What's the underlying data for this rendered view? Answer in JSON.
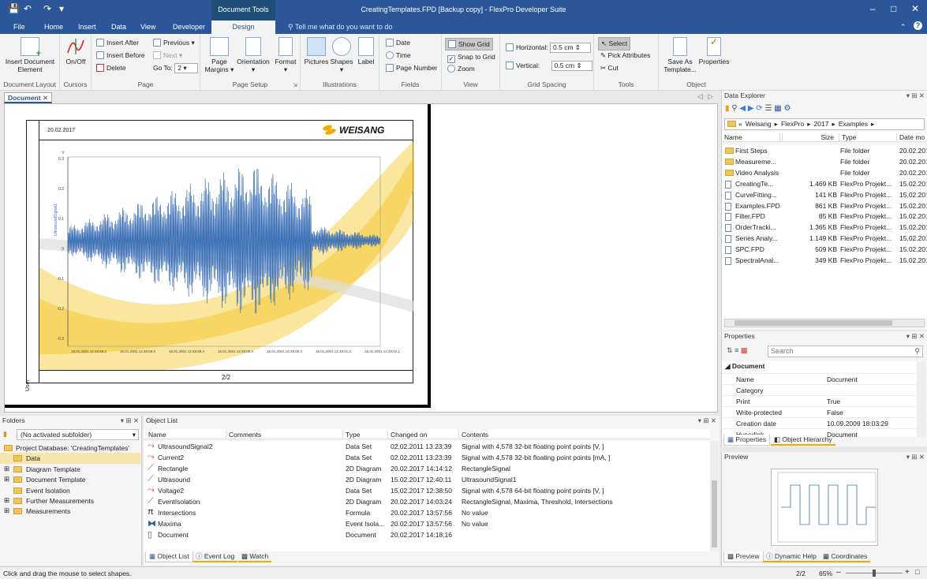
{
  "window": {
    "title": "CreatingTemplates.FPD [Backup copy] - FlexPro Developer Suite",
    "context_tab": "Document Tools"
  },
  "menu": [
    "File",
    "Home",
    "Insert",
    "Data",
    "View",
    "Developer"
  ],
  "active_tab": "Design",
  "tell_me": "Tell me what do you want to do",
  "ribbon": {
    "document_layout": {
      "label": "Document Layout",
      "insert": "Insert Document Element"
    },
    "cursors": {
      "label": "Cursors",
      "onoff": "On/Off"
    },
    "page": {
      "label": "Page",
      "insert_after": "Insert After",
      "insert_before": "Insert Before",
      "delete": "Delete",
      "previous": "Previous",
      "next": "Next",
      "goto": "Go To:",
      "goto_value": "2"
    },
    "page_setup": {
      "label": "Page Setup",
      "margins": "Page Margins",
      "orientation": "Orientation",
      "format": "Format"
    },
    "illustrations": {
      "label": "Illustrations",
      "pictures": "Pictures",
      "shapes": "Shapes",
      "label_btn": "Label"
    },
    "fields": {
      "label": "Fields",
      "date": "Date",
      "time": "Time",
      "page_number": "Page Number"
    },
    "view": {
      "label": "View",
      "show_grid": "Show Grid",
      "snap": "Snap to Grid",
      "zoom": "Zoom"
    },
    "grid_spacing": {
      "label": "Grid Spacing",
      "horizontal": "Horizontal:",
      "horizontal_value": "0.5 cm",
      "vertical": "Vertical:",
      "vertical_value": "0.5 cm"
    },
    "tools": {
      "label": "Tools",
      "select": "Select",
      "pick": "Pick Attributes",
      "cut": "Cut"
    },
    "object": {
      "label": "Object",
      "save_as": "Save As Template...",
      "properties": "Properties"
    }
  },
  "document": {
    "tab": "Document",
    "date": "20.02.2017",
    "logo": "WEISANG",
    "page_label": "2/2",
    "side_label": "User",
    "y_label": "UltrasoundSignal1",
    "y_unit": "V",
    "x_ticks": [
      "16.01.2001 12:48:58.5",
      "16.01.2001 12:48:59.0",
      "16.01.2001 12:48:59.4",
      "16.01.2001 12:49:00.0",
      "16.01.2001 12:49:00.2",
      "16.01.2001 12:49:01.0",
      "16.01.2001 12:49:02.1"
    ],
    "y_ticks": [
      "0.3",
      "0.2",
      "0.1",
      "0",
      "-0.1",
      "-0.2",
      "-0.3"
    ]
  },
  "data_explorer": {
    "title": "Data Explorer",
    "path": [
      "«",
      "Weisang",
      "FlexPro",
      "2017",
      "Examples"
    ],
    "columns": [
      "Name",
      "Size",
      "Type",
      "Date mo"
    ],
    "rows": [
      {
        "name": "First Steps",
        "size": "",
        "type": "File folder",
        "date": "20.02.201",
        "folder": true
      },
      {
        "name": "Measureme...",
        "size": "",
        "type": "File folder",
        "date": "20.02.201",
        "folder": true
      },
      {
        "name": "Video Analysis",
        "size": "",
        "type": "File folder",
        "date": "20.02.201",
        "folder": true
      },
      {
        "name": "CreatingTe...",
        "size": "1.469 KB",
        "type": "FlexPro Projekt...",
        "date": "15.02.201",
        "folder": false
      },
      {
        "name": "CurveFitting...",
        "size": "141 KB",
        "type": "FlexPro Projekt...",
        "date": "15.02.201",
        "folder": false
      },
      {
        "name": "Examples.FPD",
        "size": "861 KB",
        "type": "FlexPro Projekt...",
        "date": "15.02.201",
        "folder": false
      },
      {
        "name": "Filter.FPD",
        "size": "85 KB",
        "type": "FlexPro Projekt...",
        "date": "15.02.201",
        "folder": false
      },
      {
        "name": "OrderTracki...",
        "size": "1.365 KB",
        "type": "FlexPro Projekt...",
        "date": "15.02.201",
        "folder": false
      },
      {
        "name": "Series Analy...",
        "size": "1.149 KB",
        "type": "FlexPro Projekt...",
        "date": "15.02.201",
        "folder": false
      },
      {
        "name": "SPC.FPD",
        "size": "509 KB",
        "type": "FlexPro Projekt...",
        "date": "15.02.201",
        "folder": false
      },
      {
        "name": "SpectralAnal...",
        "size": "349 KB",
        "type": "FlexPro Projekt...",
        "date": "15.02.201",
        "folder": false
      }
    ]
  },
  "properties": {
    "title": "Properties",
    "search": "Search",
    "section": "Document",
    "rows": [
      {
        "k": "Name",
        "v": "Document"
      },
      {
        "k": "Category",
        "v": ""
      },
      {
        "k": "Print",
        "v": "True"
      },
      {
        "k": "Write-protected",
        "v": "False"
      },
      {
        "k": "Creation date",
        "v": "10.09.2009 18:03:29"
      },
      {
        "k": "Hyperlink",
        "v": "Document"
      }
    ],
    "tabs": [
      "Properties",
      "Object Hierarchy"
    ]
  },
  "preview": {
    "title": "Preview",
    "tabs": [
      "Preview",
      "Dynamic Help",
      "Coordinates"
    ]
  },
  "folders": {
    "title": "Folders",
    "filter": "(No activated subfolder)",
    "items": [
      "Project Database: 'CreatingTemplates'",
      "Data",
      "Diagram Template",
      "Document Template",
      "Event Isolation",
      "Further Measurements",
      "Measurements"
    ]
  },
  "object_list": {
    "title": "Object List",
    "columns": [
      "Name",
      "Comments",
      "Type",
      "Changed on",
      "Contents"
    ],
    "rows": [
      {
        "name": "UltrasoundSignal2",
        "type": "Data Set",
        "changed": "02.02.2011 13:23:39",
        "contents": "Signal with 4,578 32-bit floating point points [V, ]"
      },
      {
        "name": "Current2",
        "type": "Data Set",
        "changed": "02.02.2011 13:23:39",
        "contents": "Signal with 4,578 32-bit floating point points [mA, ]"
      },
      {
        "name": "Rectangle",
        "type": "2D Diagram",
        "changed": "20.02.2017 14:14:12",
        "contents": "RectangleSignal"
      },
      {
        "name": "Ultrasound",
        "type": "2D Diagram",
        "changed": "15.02.2017 12:40:11",
        "contents": "UltrasoundSignal1"
      },
      {
        "name": "Voltage2",
        "type": "Data Set",
        "changed": "15.02.2017 12:38:50",
        "contents": "Signal with 4,578 64-bit floating point points [V, ]"
      },
      {
        "name": "EventIsolation",
        "type": "2D Diagram",
        "changed": "20.02.2017 14:03:24",
        "contents": "RectangleSignal, Maxima, Threshold, Intersections"
      },
      {
        "name": "Intersections",
        "type": "Formula",
        "changed": "20.02.2017 13:57:56",
        "contents": "No value"
      },
      {
        "name": "Maxima",
        "type": "Event Isola...",
        "changed": "20.02.2017 13:57:56",
        "contents": "No value"
      },
      {
        "name": "Document",
        "type": "Document",
        "changed": "20.02.2017 14:18:16",
        "contents": ""
      }
    ],
    "tabs": [
      "Object List",
      "Event Log",
      "Watch"
    ]
  },
  "status": {
    "message": "Click and drag the mouse to select shapes.",
    "page": "2/2",
    "zoom": "65%"
  }
}
